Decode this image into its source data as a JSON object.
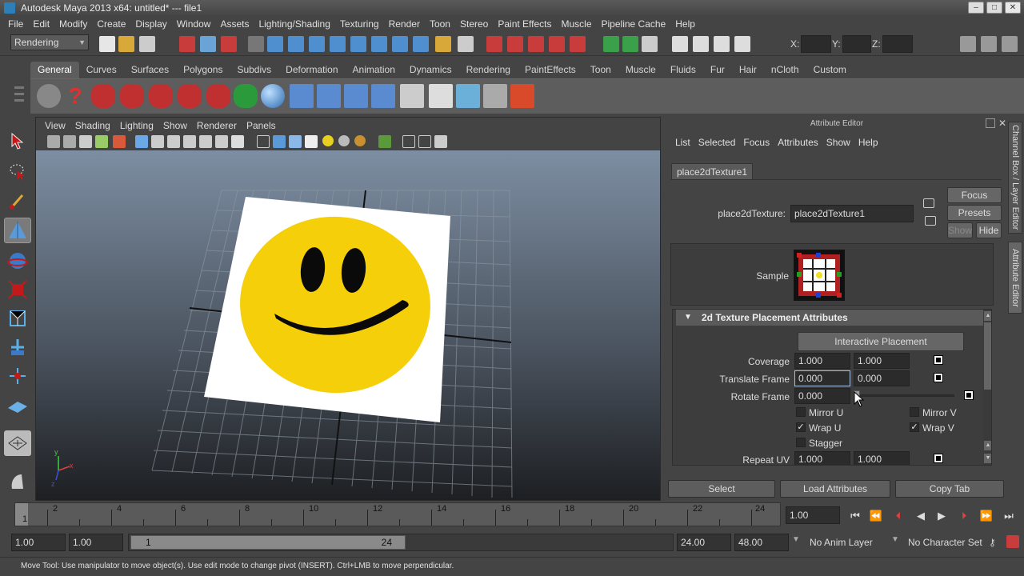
{
  "window": {
    "title": "Autodesk Maya 2013 x64: untitled*   ---   file1"
  },
  "menubar": [
    "File",
    "Edit",
    "Modify",
    "Create",
    "Display",
    "Window",
    "Assets",
    "Lighting/Shading",
    "Texturing",
    "Render",
    "Toon",
    "Stereo",
    "Paint Effects",
    "Muscle",
    "Pipeline Cache",
    "Help"
  ],
  "status": {
    "menuset": "Rendering",
    "x_label": "X:",
    "y_label": "Y:",
    "z_label": "Z:"
  },
  "shelf_tabs": [
    "General",
    "Curves",
    "Surfaces",
    "Polygons",
    "Subdivs",
    "Deformation",
    "Animation",
    "Dynamics",
    "Rendering",
    "PaintEffects",
    "Toon",
    "Muscle",
    "Fluids",
    "Fur",
    "Hair",
    "nCloth",
    "Custom"
  ],
  "viewport": {
    "menu": [
      "View",
      "Shading",
      "Lighting",
      "Show",
      "Renderer",
      "Panels"
    ]
  },
  "attribute_editor": {
    "title": "Attribute Editor",
    "menu": [
      "List",
      "Selected",
      "Focus",
      "Attributes",
      "Show",
      "Help"
    ],
    "node_tab": "place2dTexture1",
    "node_label": "place2dTexture:",
    "node_value": "place2dTexture1",
    "focus_btn": "Focus",
    "presets_btn": "Presets",
    "show_btn": "Show",
    "hide_btn": "Hide",
    "sample_label": "Sample",
    "section_title": "2d Texture Placement Attributes",
    "interactive_placement": "Interactive Placement",
    "coverage_label": "Coverage",
    "coverage_u": "1.000",
    "coverage_v": "1.000",
    "translate_label": "Translate Frame",
    "translate_u": "0.000",
    "translate_v": "0.000",
    "rotate_label": "Rotate Frame",
    "rotate_value": "0.000",
    "mirror_u": "Mirror U",
    "mirror_v": "Mirror V",
    "wrap_u": "Wrap U",
    "wrap_v": "Wrap V",
    "stagger": "Stagger",
    "repeat_label": "Repeat UV",
    "repeat_u": "1.000",
    "repeat_v": "1.000",
    "select_btn": "Select",
    "load_btn": "Load Attributes",
    "copy_btn": "Copy Tab"
  },
  "side_tabs": {
    "channel_box": "Channel Box / Layer Editor",
    "attribute_editor": "Attribute Editor"
  },
  "timeline": {
    "labels": [
      "2",
      "4",
      "6",
      "8",
      "10",
      "12",
      "14",
      "16",
      "18",
      "20",
      "22",
      "24"
    ],
    "current_frame_marker": "1",
    "current_time": "1.00"
  },
  "range": {
    "start": "1.00",
    "playback_start": "1.00",
    "slider_start": "1",
    "slider_end": "24",
    "playback_end": "24.00",
    "end": "48.00",
    "anim_layer": "No Anim Layer",
    "character_set": "No Character Set"
  },
  "help_line": "Move Tool: Use manipulator to move object(s). Use edit mode to change pivot (INSERT).  Ctrl+LMB to move perpendicular."
}
